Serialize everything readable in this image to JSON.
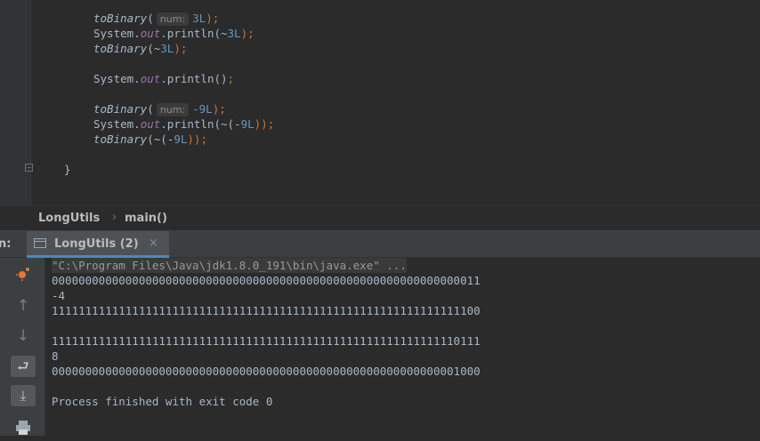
{
  "editor": {
    "lines": [
      {
        "fn": "toBinary",
        "hint": "num:",
        "arg": "3L",
        "suffix": ");"
      },
      {
        "prefix": "System.",
        "out": "out",
        "mid": ".println(~",
        "arg": "3L",
        "suffix": ");"
      },
      {
        "fn": "toBinary",
        "open": "(~",
        "arg": "3L",
        "suffix": ");"
      },
      {
        "prefix": "System.",
        "out": "out",
        "mid": ".println()",
        "suffix": ";"
      },
      {
        "fn": "toBinary",
        "hint": "num:",
        "arg": "-9L",
        "suffix": ");"
      },
      {
        "prefix": "System.",
        "out": "out",
        "mid": ".println(~(-",
        "arg": "9L",
        "suffix": "));"
      },
      {
        "fn": "toBinary",
        "open": "(~(-",
        "arg": "9L",
        "suffix": "));"
      },
      {
        "brace": "}"
      }
    ]
  },
  "breadcrumb": {
    "class_name": "LongUtils",
    "separator": "›",
    "method_name": "main()"
  },
  "run_panel": {
    "label": "n:",
    "tab_label": "LongUtils (2)",
    "close_glyph": "×"
  },
  "toolbar_icons": [
    "rerun-icon",
    "up-arrow-icon",
    "down-arrow-icon",
    "soft-wrap-icon",
    "scroll-to-end-icon",
    "print-icon"
  ],
  "console": {
    "command": "\"C:\\Program Files\\Java\\jdk1.8.0_191\\bin\\java.exe\" ...",
    "output": [
      "0000000000000000000000000000000000000000000000000000000000000011",
      "-4",
      "1111111111111111111111111111111111111111111111111111111111111100",
      "",
      "1111111111111111111111111111111111111111111111111111111111110111",
      "8",
      "0000000000000000000000000000000000000000000000000000000000001000",
      "",
      "Process finished with exit code 0"
    ]
  },
  "colors": {
    "keyword": "#cc7832",
    "number": "#6897bb",
    "static_field": "#9876aa",
    "text": "#a9b7c6",
    "rerun_icon": "#e8773a"
  }
}
